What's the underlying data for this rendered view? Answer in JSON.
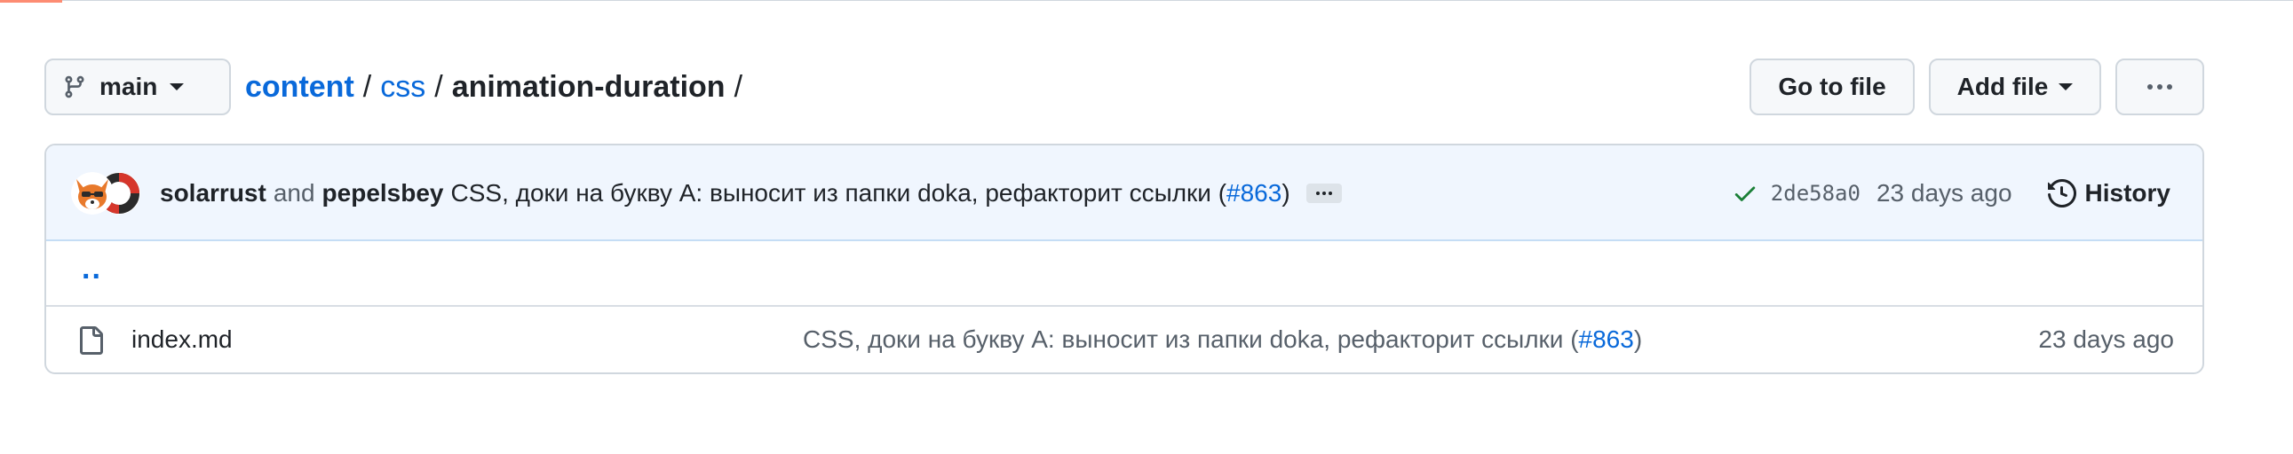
{
  "colors": {
    "link": "#0969da",
    "text": "#1f2328",
    "muted": "#57606a",
    "border": "#d0d7de",
    "commit_bar_bg": "#f0f6fe",
    "success": "#1a7f37",
    "accent_tab": "#fd8c73"
  },
  "branch": {
    "icon": "git-branch-icon",
    "name": "main"
  },
  "breadcrumb": {
    "repo": "content",
    "folder": "css",
    "current": "animation-duration",
    "separator": "/"
  },
  "actions": {
    "go_to_file": "Go to file",
    "add_file": "Add file",
    "more_icon": "kebab-horizontal-icon"
  },
  "latest_commit": {
    "author1": "solarrust",
    "conjunction": "and",
    "author2": "pepelsbey",
    "message": "CSS, доки на букву А: выносит из папки doka, рефакторит ссылки (",
    "pr": "#863",
    "message_end": ")",
    "status_icon": "check-icon",
    "sha": "2de58a0",
    "time": "23 days ago",
    "history_icon": "history-icon",
    "history_label": "History"
  },
  "parent_dir": {
    "label": ".."
  },
  "files": [
    {
      "icon": "file-icon",
      "name": "index.md",
      "message": "CSS, доки на букву А: выносит из папки doka, рефакторит ссылки (",
      "pr": "#863",
      "message_end": ")",
      "time": "23 days ago"
    }
  ]
}
